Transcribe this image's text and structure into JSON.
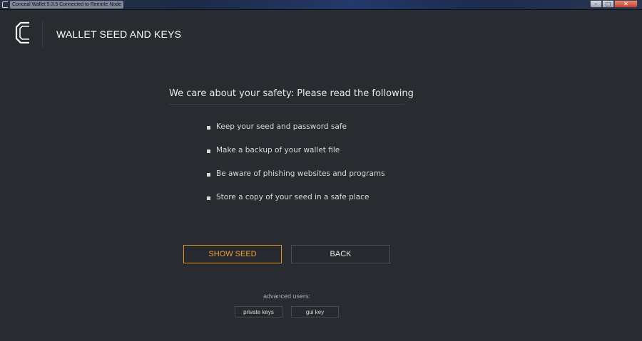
{
  "window": {
    "title": "Conceal Wallet 5.3.5 Connected to Remote Node",
    "buttons": {
      "minimize": "–",
      "maximize": "□",
      "close": "✕"
    }
  },
  "header": {
    "logo_icon": "conceal-logo",
    "title": "WALLET SEED AND KEYS"
  },
  "main": {
    "headline": "We care about your safety: Please read the following",
    "tips": [
      "Keep your seed and password safe",
      "Make a backup of your wallet file",
      "Be aware of phishing websites and programs",
      "Store a copy of your seed in a safe place"
    ],
    "show_seed_label": "SHOW SEED",
    "back_label": "BACK",
    "advanced_label": "advanced users:",
    "private_keys_label": "private keys",
    "gui_key_label": "gui key"
  },
  "colors": {
    "background": "#282b30",
    "accent": "#f2a13a",
    "text": "#e9eaec"
  }
}
